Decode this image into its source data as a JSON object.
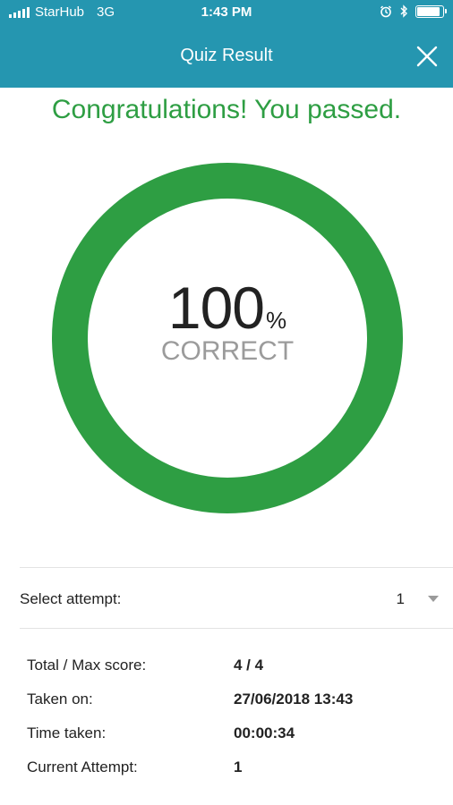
{
  "status_bar": {
    "carrier": "StarHub",
    "network": "3G",
    "time": "1:43 PM",
    "battery_level": 0.9,
    "icons": [
      "signal-icon",
      "alarm-icon",
      "bluetooth-icon",
      "battery-icon"
    ]
  },
  "header": {
    "title": "Quiz Result",
    "close_icon": "close-icon"
  },
  "result": {
    "message": "Congratulations! You passed.",
    "percent_value": "100",
    "percent_symbol": "%",
    "percent_fraction": 1.0,
    "caption": "CORRECT"
  },
  "attempt_select": {
    "label": "Select attempt:",
    "value": "1"
  },
  "details": [
    {
      "label": "Total / Max score:",
      "value": "4 / 4"
    },
    {
      "label": "Taken on:",
      "value": "27/06/2018 13:43"
    },
    {
      "label": "Time taken:",
      "value": "00:00:34"
    },
    {
      "label": "Current Attempt:",
      "value": "1"
    }
  ],
  "colors": {
    "header_bg": "#2596b0",
    "success": "#2e9e43",
    "ring_track": "#e6e6e6",
    "muted_text": "#9b9b9b"
  }
}
